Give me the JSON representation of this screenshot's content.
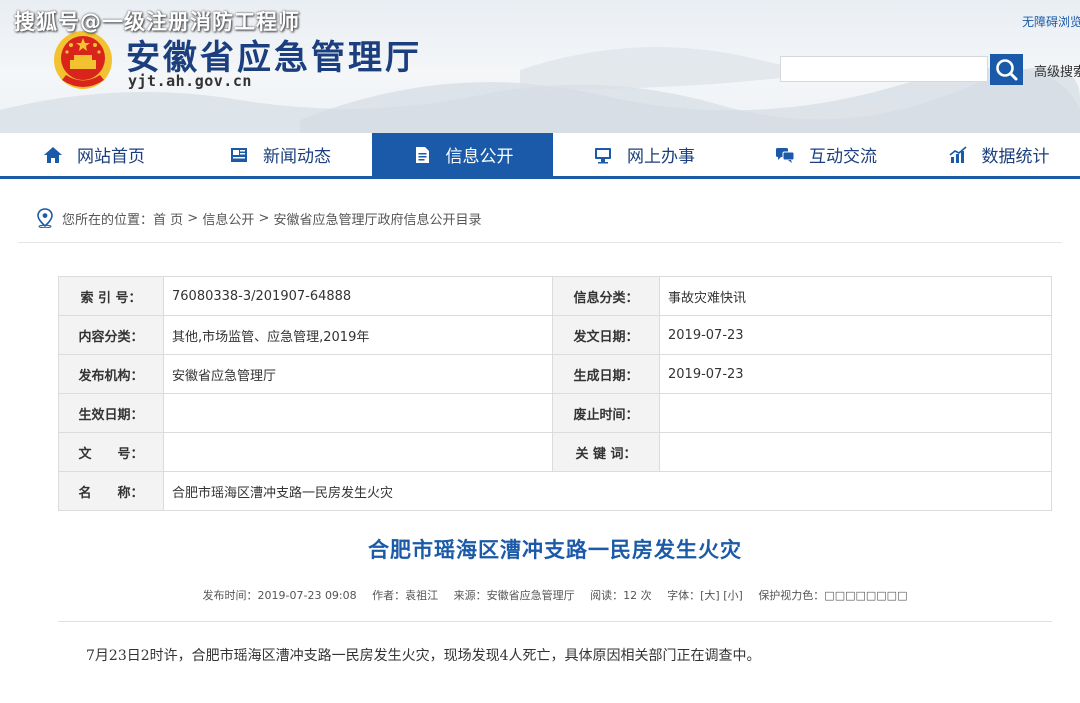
{
  "watermark": "搜狐号@一级注册消防工程师",
  "site": {
    "title": "安徽省应急管理厅",
    "url": "yjt.ah.gov.cn",
    "accessibility": "无障碍浏览",
    "search_placeholder": "",
    "advanced_search": "高级搜索"
  },
  "nav": {
    "items": [
      {
        "label": "网站首页",
        "icon": "home-icon"
      },
      {
        "label": "新闻动态",
        "icon": "news-icon"
      },
      {
        "label": "信息公开",
        "icon": "document-icon",
        "active": true
      },
      {
        "label": "网上办事",
        "icon": "monitor-icon"
      },
      {
        "label": "互动交流",
        "icon": "chat-icon"
      },
      {
        "label": "数据统计",
        "icon": "bar-chart-icon"
      }
    ]
  },
  "breadcrumb": {
    "prefix": "您所在的位置：",
    "items": [
      "首 页",
      "信息公开",
      "安徽省应急管理厅政府信息公开目录"
    ]
  },
  "meta": {
    "rows": [
      {
        "l1": "索 引 号：",
        "v1": "76080338-3/201907-64888",
        "l2": "信息分类：",
        "v2": "事故灾难快讯"
      },
      {
        "l1": "内容分类：",
        "v1": "其他,市场监管、应急管理,2019年",
        "l2": "发文日期：",
        "v2": "2019-07-23"
      },
      {
        "l1": "发布机构：",
        "v1": "安徽省应急管理厅",
        "l2": "生成日期：",
        "v2": "2019-07-23"
      },
      {
        "l1": "生效日期：",
        "v1": "",
        "l2": "废止时间：",
        "v2": ""
      },
      {
        "l1": "文　　号：",
        "v1": "",
        "l2": "关 键 词：",
        "v2": ""
      },
      {
        "l1": "名　　称：",
        "v1": "合肥市瑶海区漕冲支路一民房发生火灾"
      }
    ]
  },
  "article": {
    "title": "合肥市瑶海区漕冲支路一民房发生火灾",
    "publish_time": "发布时间：2019-07-23 09:08",
    "author": "作者：袁祖江",
    "source": "来源：安徽省应急管理厅",
    "reads": "阅读：12 次",
    "font_size": "字体：[大] [小]",
    "eye_care": "保护视力色：□□□□□□□□",
    "body": "7月23日2时许，合肥市瑶海区漕冲支路一民房发生火灾，现场发现4人死亡，具体原因相关部门正在调查中。"
  },
  "colors": {
    "brand": "#1b5aa8",
    "title_blue": "#1b3f7e",
    "emblem_red": "#d8241b",
    "emblem_gold": "#f2c230"
  }
}
